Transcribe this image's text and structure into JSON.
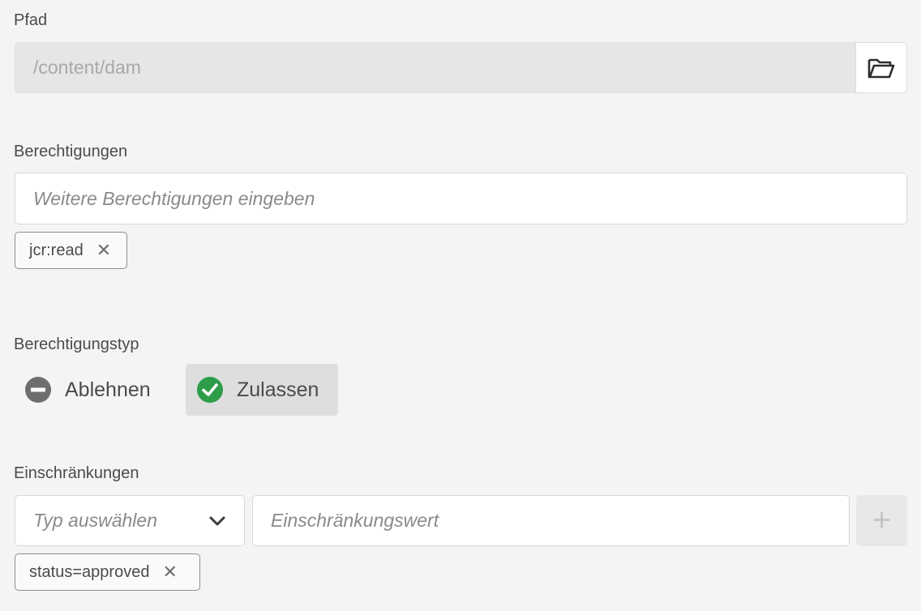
{
  "path": {
    "label": "Pfad",
    "value": "/content/dam",
    "browse_icon": "folder-open-icon"
  },
  "permissions": {
    "label": "Berechtigungen",
    "placeholder": "Weitere Berechtigungen eingeben",
    "tags": [
      {
        "text": "jcr:read"
      }
    ]
  },
  "permission_type": {
    "label": "Berechtigungstyp",
    "options": [
      {
        "label": "Ablehnen",
        "icon": "minus-circle-icon",
        "color": "#6e6e6e",
        "selected": false
      },
      {
        "label": "Zulassen",
        "icon": "checkmark-circle-icon",
        "color": "#2d9d4a",
        "selected": true
      }
    ]
  },
  "restrictions": {
    "label": "Einschränkungen",
    "type_placeholder": "Typ auswählen",
    "value_placeholder": "Einschränkungswert",
    "add_label": "+",
    "tags": [
      {
        "text": "status=approved"
      }
    ]
  },
  "remove_symbol": "✕"
}
